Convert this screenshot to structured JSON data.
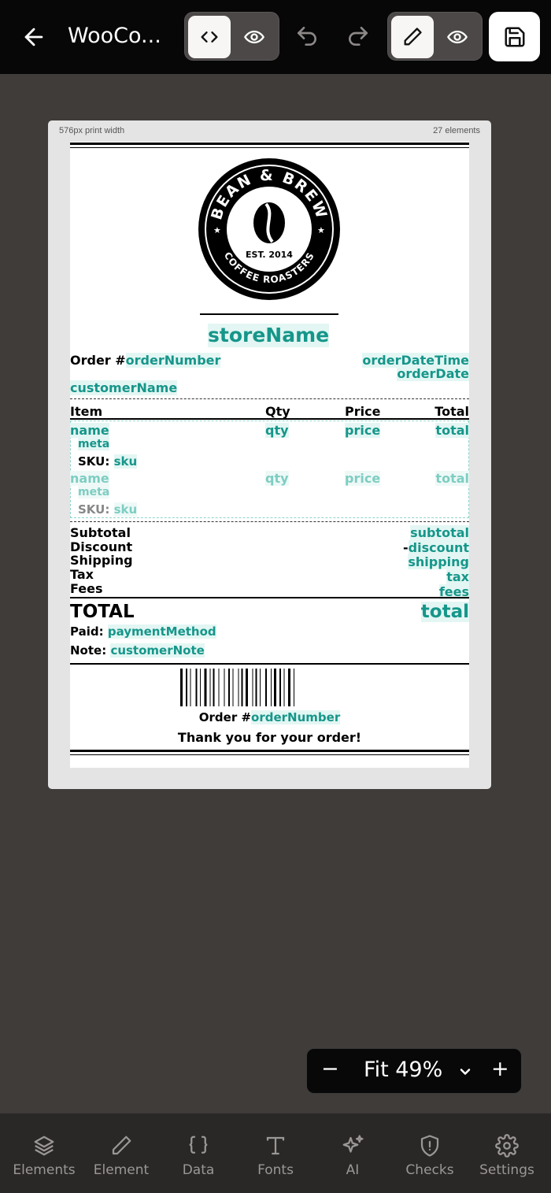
{
  "header": {
    "title": "WooCo...",
    "mode_code_icon": "code-icon",
    "mode_preview_icon": "eye-icon",
    "edit_icon": "pencil-icon",
    "preview_icon": "eye-icon",
    "save_icon": "save-icon"
  },
  "canvas": {
    "print_width": "576px print width",
    "element_count": "27 elements"
  },
  "receipt": {
    "logo": {
      "top_text": "BEAN & BREW",
      "est": "EST. 2014",
      "bottom_text": "COFFEE ROASTERS"
    },
    "store_name": "storeName",
    "order_label": "Order #",
    "order_number": "orderNumber",
    "order_date_time": "orderDateTime",
    "order_date": "orderDate",
    "customer_name": "customerName",
    "columns": {
      "item": "Item",
      "qty": "Qty",
      "price": "Price",
      "total": "Total"
    },
    "rows": [
      {
        "name": "name",
        "qty": "qty",
        "price": "price",
        "total": "total",
        "meta": "meta",
        "sku_label": "SKU:",
        "sku": "sku"
      },
      {
        "name": "name",
        "qty": "qty",
        "price": "price",
        "total": "total",
        "meta": "meta",
        "sku_label": "SKU:",
        "sku": "sku"
      }
    ],
    "summary": [
      {
        "label": "Subtotal",
        "value": "subtotal"
      },
      {
        "label": "Discount",
        "value": "discount",
        "prefix": "-"
      },
      {
        "label": "Shipping",
        "value": "shipping"
      },
      {
        "label": "Tax",
        "value": "tax"
      },
      {
        "label": "Fees",
        "value": "fees"
      }
    ],
    "total_label": "TOTAL",
    "total_value": "total",
    "paid_label": "Paid:",
    "payment_method": "paymentMethod",
    "note_label": "Note:",
    "customer_note": "customerNote",
    "barcode_order_label": "Order #",
    "barcode_order_number": "orderNumber",
    "thanks": "Thank you for your order!"
  },
  "zoom": {
    "label": "Fit 49%"
  },
  "nav": [
    {
      "label": "Elements",
      "icon": "layers-icon"
    },
    {
      "label": "Element",
      "icon": "pencil-icon"
    },
    {
      "label": "Data",
      "icon": "braces-icon"
    },
    {
      "label": "Fonts",
      "icon": "type-icon"
    },
    {
      "label": "AI",
      "icon": "sparkles-icon"
    },
    {
      "label": "Checks",
      "icon": "shield-alert-icon"
    },
    {
      "label": "Settings",
      "icon": "gear-icon"
    }
  ]
}
